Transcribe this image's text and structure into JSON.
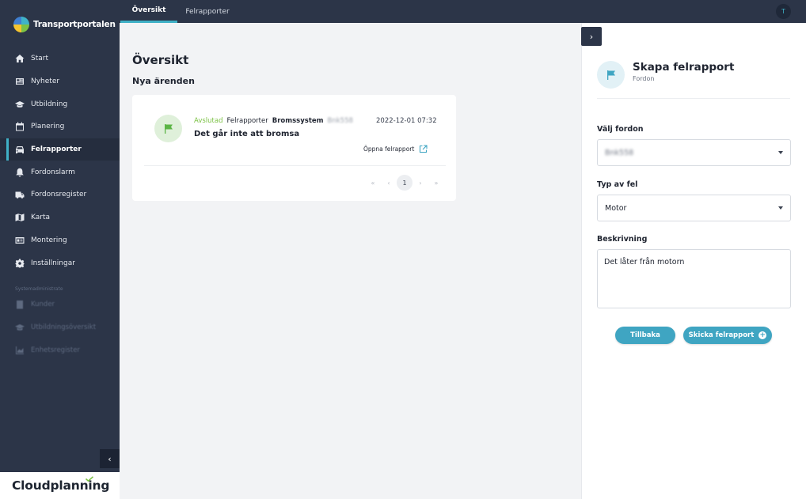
{
  "app": {
    "name": "Transportportalen"
  },
  "sidebar": {
    "items": [
      {
        "label": "Start",
        "icon": "home-icon"
      },
      {
        "label": "Nyheter",
        "icon": "news-icon"
      },
      {
        "label": "Utbildning",
        "icon": "graduation-cap-icon"
      },
      {
        "label": "Planering",
        "icon": "calendar-icon"
      },
      {
        "label": "Felrapporter",
        "icon": "car-icon",
        "active": true
      },
      {
        "label": "Fordonslarm",
        "icon": "bell-icon"
      },
      {
        "label": "Fordonsregister",
        "icon": "truck-icon"
      },
      {
        "label": "Karta",
        "icon": "map-icon"
      },
      {
        "label": "Montering",
        "icon": "id-card-icon"
      },
      {
        "label": "Inställningar",
        "icon": "gear-icon"
      }
    ],
    "system_label": "Systemadministrate",
    "system_items": [
      {
        "label": "Kunder"
      },
      {
        "label": "Utbildningsöversikt"
      },
      {
        "label": "Enhetsregister"
      }
    ],
    "footer_brand": "Cloudplanning"
  },
  "topbar": {
    "tabs": [
      {
        "label": "Översikt",
        "active": true
      },
      {
        "label": "Felrapporter",
        "active": false
      }
    ],
    "avatar_initial": "T"
  },
  "main": {
    "title": "Översikt",
    "section_title": "Nya ärenden",
    "report": {
      "status": "Avslutad",
      "category": "Felrapporter",
      "subcategory": "Bromssystem",
      "vehicle": "Bnk558",
      "date": "2022-12-01 07:32",
      "title": "Det går inte att bromsa",
      "open_link": "Öppna felrapport"
    },
    "pagination": {
      "first": "«",
      "prev": "‹",
      "current": "1",
      "next": "›",
      "last": "»"
    }
  },
  "panel": {
    "title": "Skapa felrapport",
    "subtitle": "Fordon",
    "vehicle_label": "Välj fordon",
    "vehicle_value": "Bnk558",
    "fault_type_label": "Typ av fel",
    "fault_type_value": "Motor",
    "description_label": "Beskrivning",
    "description_value": "Det låter från motorn",
    "back_button": "Tillbaka",
    "submit_button": "Skicka felrapport"
  },
  "colors": {
    "sidebar_bg": "#2c3548",
    "accent": "#3fb0c6",
    "button": "#3fa5c2",
    "status_green": "#7cc245"
  }
}
